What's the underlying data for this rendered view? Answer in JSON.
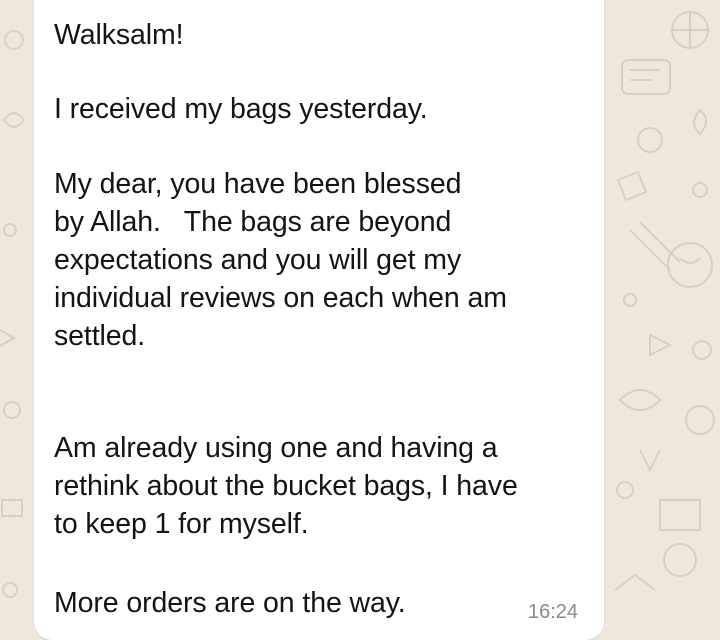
{
  "message": {
    "greeting": "Walksalm!",
    "line_received": "I received my bags yesterday.",
    "paragraph_blessed": "My dear, you have been blessed\nby Allah.   The bags are beyond\nexpectations and you will get my\nindividual reviews on each when am\nsettled.",
    "paragraph_using": "Am already using one and having a\nrethink about the bucket bags, I have\nto keep 1 for myself.",
    "line_orders": "More orders are on the way.",
    "time": "16:24"
  },
  "colors": {
    "wallpaper": "#efe7dc",
    "doodle": "#d9cfc0",
    "bubble": "#ffffff",
    "text": "#141414",
    "timestamp": "#8a8a8a"
  }
}
